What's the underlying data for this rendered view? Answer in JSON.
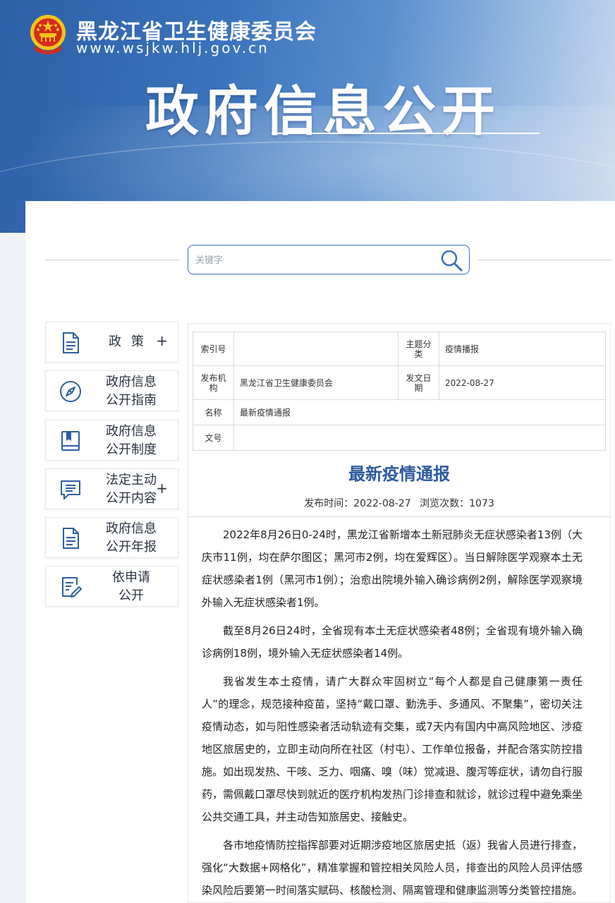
{
  "header": {
    "site_name": "黑龙江省卫生健康委员会",
    "site_url": "www.wsjkw.hlj.gov.cn",
    "page_title": "政府信息公开"
  },
  "search": {
    "placeholder": "关键字"
  },
  "sidebar": {
    "items": [
      {
        "label": "政策",
        "has_plus": true,
        "icon": "document-icon"
      },
      {
        "label": "政府信息\n公开指南",
        "has_plus": false,
        "icon": "compass-icon"
      },
      {
        "label": "政府信息\n公开制度",
        "has_plus": false,
        "icon": "book-icon"
      },
      {
        "label": "法定主动\n公开内容",
        "has_plus": true,
        "icon": "chat-list-icon"
      },
      {
        "label": "政府信息\n公开年报",
        "has_plus": false,
        "icon": "report-icon"
      },
      {
        "label": "依申请\n公开",
        "has_plus": false,
        "icon": "edit-form-icon"
      }
    ],
    "plus": "+"
  },
  "meta": {
    "index_label": "索引号",
    "index_value": "",
    "topic_label": "主题分类",
    "topic_value": "疫情播报",
    "issuer_label": "发布机构",
    "issuer_value": "黑龙江省卫生健康委员会",
    "date_label": "发文日期",
    "date_value": "2022-08-27",
    "name_label": "名称",
    "name_value": "最新疫情通报",
    "doc_no_label": "文号",
    "doc_no_value": ""
  },
  "article": {
    "title": "最新疫情通报",
    "publish_time": "发布时间：2022-08-27",
    "view_count": "浏览次数：1073",
    "paragraphs": [
      "2022年8月26日0-24时，黑龙江省新增本土新冠肺炎无症状感染者13例（大庆市11例，均在萨尔图区；黑河市2例，均在爱辉区）。当日解除医学观察本土无症状感染者1例（黑河市1例）；治愈出院境外输入确诊病例2例，解除医学观察境外输入无症状感染者1例。",
      "截至8月26日24时，全省现有本土无症状感染者48例；全省现有境外输入确诊病例18例，境外输入无症状感染者14例。",
      "我省发生本土疫情，请广大群众牢固树立“每个人都是自己健康第一责任人”的理念，规范接种疫苗，坚持“戴口罩、勤洗手、多通风、不聚集”，密切关注疫情动态，如与阳性感染者活动轨迹有交集，或7天内有国内中高风险地区、涉疫地区旅居史的，立即主动向所在社区（村屯）、工作单位报备，并配合落实防控措施。如出现发热、干咳、乏力、咽痛、嗅（味）觉减退、腹泻等症状，请勿自行服药，需佩戴口罩尽快到就近的医疗机构发热门诊排查和就诊，就诊过程中避免乘坐公共交通工具，并主动告知旅居史、接触史。",
      "各市地疫情防控指挥部要对近期涉疫地区旅居史抵（返）我省人员进行排查，强化“大数据+网格化”，精准掌握和管控相关风险人员，排查出的风险人员评估感染风险后要第一时间落实赋码、核酸检测、隔离管理和健康监测等分类管控措施。"
    ]
  },
  "colors": {
    "banner_blue": "#2d5fa6",
    "title_blue": "#2c5aa0",
    "emblem_red": "#d52b1e",
    "emblem_gold": "#f5c518"
  }
}
